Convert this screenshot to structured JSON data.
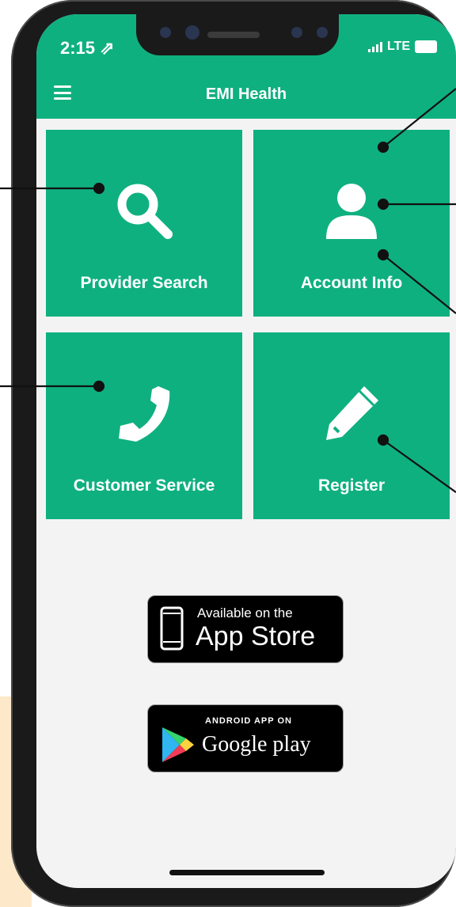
{
  "status": {
    "time": "2:15 ⇗",
    "network": "LTE"
  },
  "header": {
    "title": "EMI Health"
  },
  "tiles": [
    {
      "label": "Provider Search",
      "icon": "search-icon"
    },
    {
      "label": "Account Info",
      "icon": "user-icon"
    },
    {
      "label": "Customer Service",
      "icon": "phone-icon"
    },
    {
      "label": "Register",
      "icon": "pencil-icon"
    }
  ],
  "badges": {
    "app_store": {
      "line1": "Available on the",
      "line2": "App Store"
    },
    "google_play": {
      "line1": "ANDROID APP ON",
      "line2": "Google play"
    }
  },
  "colors": {
    "brand": "#0fb080",
    "background": "#f3f3f3"
  }
}
